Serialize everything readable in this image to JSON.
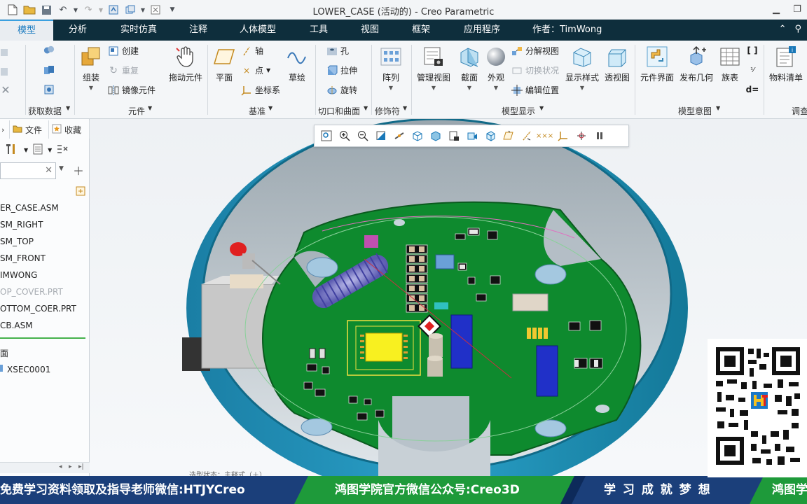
{
  "window": {
    "title": "LOWER_CASE (活动的) - Creo Parametric"
  },
  "tabs": [
    {
      "label": "模型",
      "active": true
    },
    {
      "label": "分析"
    },
    {
      "label": "实时仿真"
    },
    {
      "label": "注释"
    },
    {
      "label": "人体模型"
    },
    {
      "label": "工具"
    },
    {
      "label": "视图"
    },
    {
      "label": "框架"
    },
    {
      "label": "应用程序"
    }
  ],
  "author_label": "作者：TimWong",
  "ribbon": {
    "get_data_label": "获取数据",
    "component": {
      "assemble": "组装",
      "create": "创建",
      "repeat": "重复",
      "mirror": "镜像元件",
      "drag": "拖动元件",
      "group_label": "元件"
    },
    "datum": {
      "plane": "平面",
      "axis": "轴",
      "point": "点",
      "csys": "坐标系",
      "sketch": "草绘",
      "group_label": "基准"
    },
    "cut_surface": {
      "hole": "孔",
      "extrude": "拉伸",
      "revolve": "旋转",
      "group_label": "切口和曲面"
    },
    "modifier": {
      "pattern": "阵列",
      "group_label": "修饰符"
    },
    "model_display": {
      "manage_views": "管理视图",
      "section": "截面",
      "appearance": "外观",
      "exploded_view": "分解视图",
      "toggle_status": "切换状况",
      "edit_position": "编辑位置",
      "display_style": "显示样式",
      "perspective": "透视图",
      "group_label": "模型显示"
    },
    "model_intent": {
      "component_interface": "元件界面",
      "publish_geometry": "发布几何",
      "family_table": "族表",
      "group_label": "模型意图"
    },
    "bom": "物料清单",
    "investigate_partial": "调查"
  },
  "left_panel": {
    "tabs": [
      {
        "label": ""
      },
      {
        "label": "文件"
      },
      {
        "label": "收藏"
      }
    ],
    "search_placeholder": "",
    "tree": [
      {
        "label": "ER_CASE.ASM"
      },
      {
        "label": "SM_RIGHT"
      },
      {
        "label": "SM_TOP"
      },
      {
        "label": "SM_FRONT"
      },
      {
        "label": "IMWONG"
      },
      {
        "label": "OP_COVER.PRT",
        "dim": true
      },
      {
        "label": "OTTOM_COER.PRT"
      },
      {
        "label": "CB.ASM"
      },
      {
        "label": "面"
      },
      {
        "label": "XSEC0001"
      }
    ]
  },
  "viewport": {
    "status_note": "选型状态：主释式（＋）"
  },
  "banner": {
    "segments": [
      "免费学习资料领取及指导老师微信:HTJYCreo",
      "鸿图学院官方微信公众号:Creo3D",
      "学 习 成 就 梦 想",
      "鸿图学"
    ]
  },
  "colors": {
    "tab_bar": "#0e2e3c",
    "accent": "#3aa0e0",
    "pcb": "#0e8a2e",
    "case_outer": "#1a8fb0",
    "banner_blue": "#1b3f7a",
    "banner_green": "#1e9a3a"
  }
}
